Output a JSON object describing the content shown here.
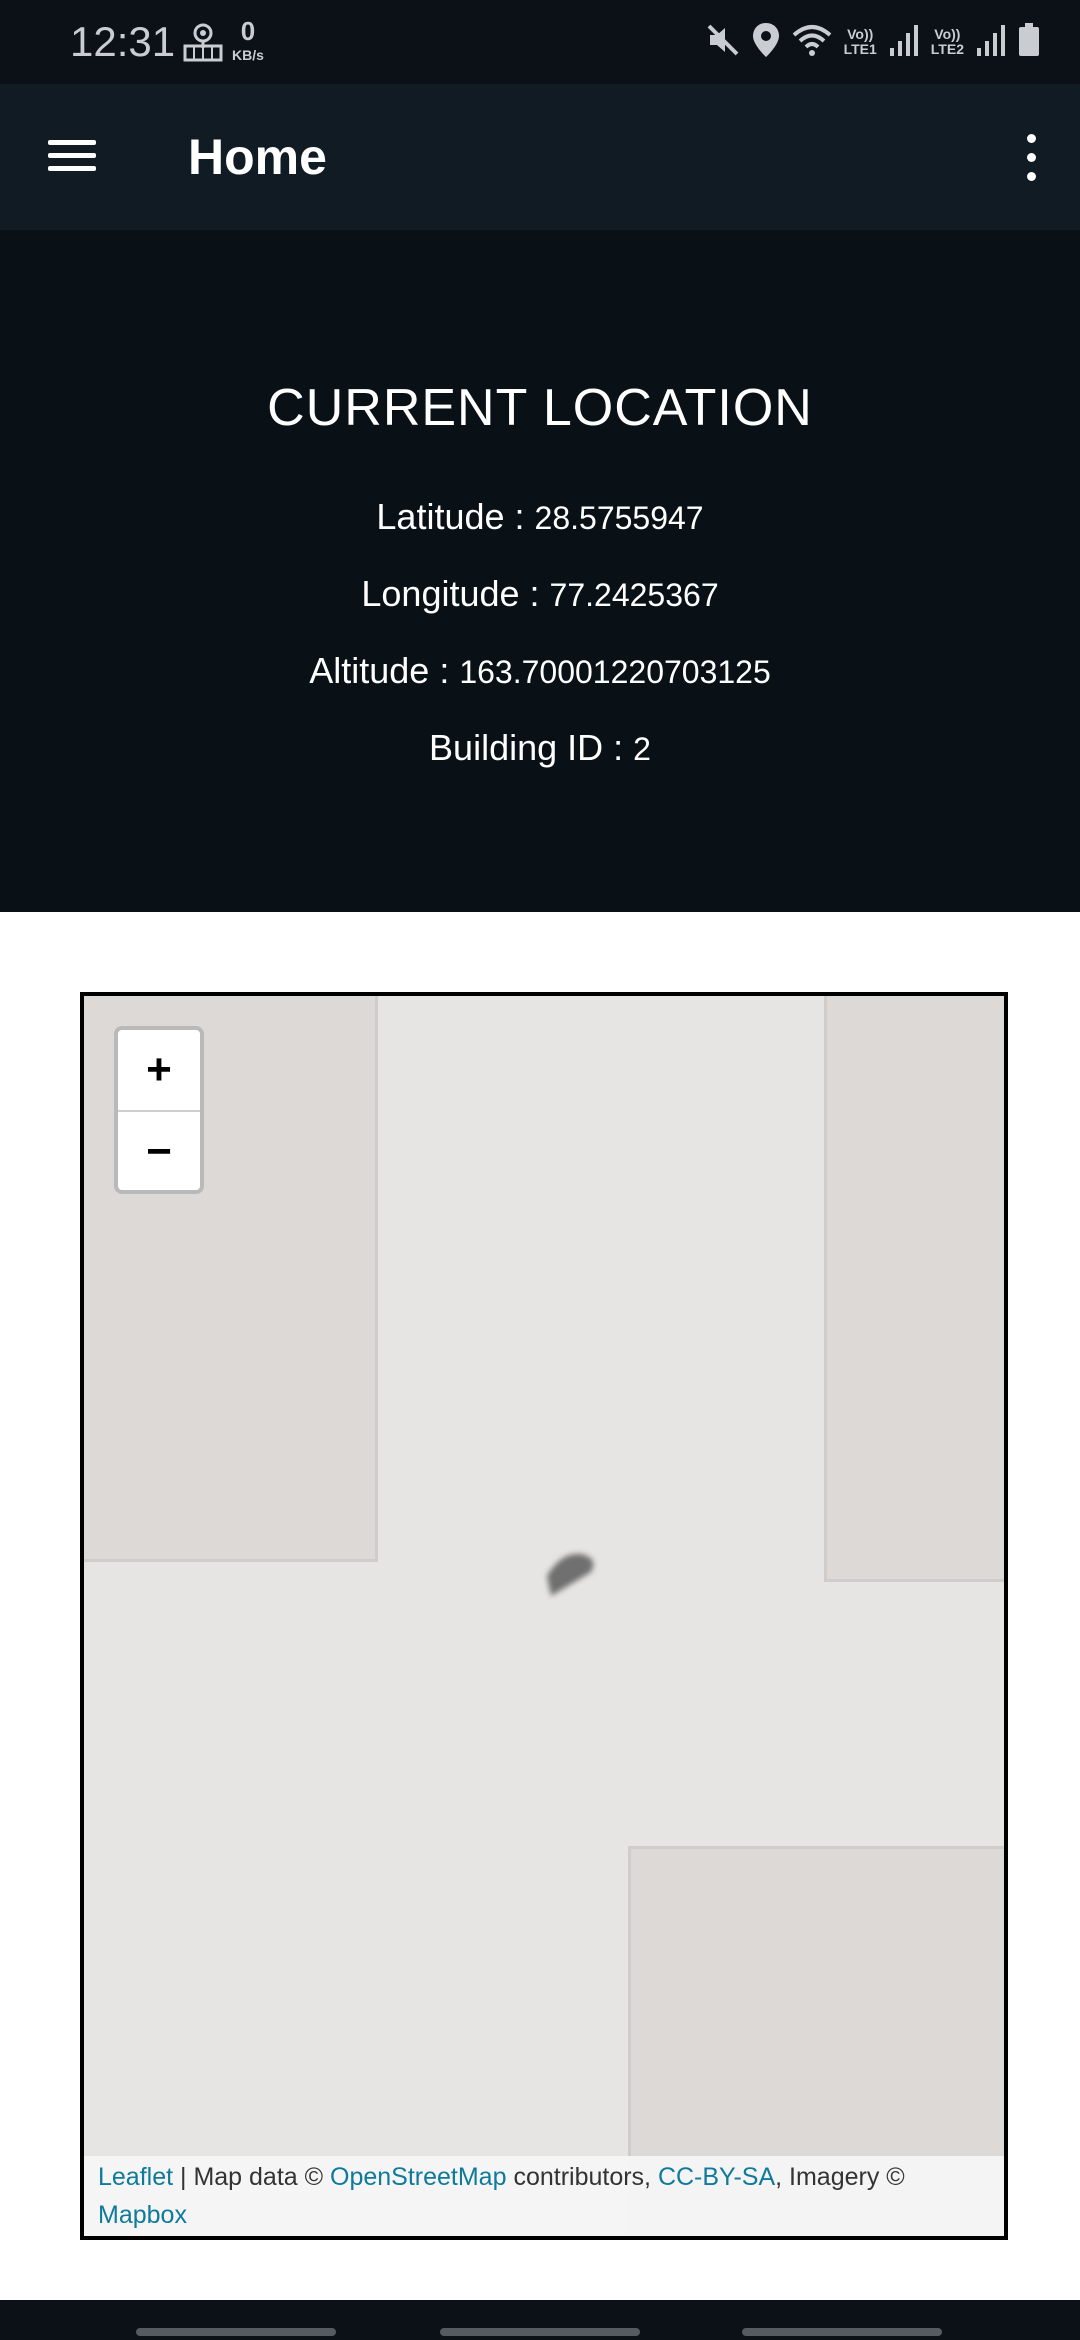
{
  "status_bar": {
    "time": "12:31",
    "net_speed_value": "0",
    "net_speed_unit": "KB/s",
    "sim1_label_top": "Vo))",
    "sim1_label_bottom": "LTE1",
    "sim2_label_top": "Vo))",
    "sim2_label_bottom": "LTE2",
    "icons": [
      "map-pin-notification-icon",
      "mute-icon",
      "location-icon",
      "wifi-icon",
      "signal-icon",
      "battery-icon"
    ]
  },
  "app_bar": {
    "title": "Home",
    "icons": [
      "hamburger-menu-icon",
      "overflow-menu-icon"
    ]
  },
  "location": {
    "heading": "CURRENT LOCATION",
    "latitude_label": "Latitude : ",
    "latitude_value": "28.5755947",
    "longitude_label": "Longitude : ",
    "longitude_value": "77.2425367",
    "altitude_label": "Altitude : ",
    "altitude_value": "163.70001220703125",
    "building_label": "Building ID : ",
    "building_value": "2"
  },
  "map": {
    "zoom_in": "+",
    "zoom_out": "−",
    "attribution": {
      "leaflet": "Leaflet",
      "sep1": " | Map data © ",
      "osm": "OpenStreetMap",
      "sep2": " contributors, ",
      "license": "CC-BY-SA",
      "sep3": ", Imagery © ",
      "mapbox": "Mapbox"
    }
  },
  "colors": {
    "status_bar_bg": "#0b1117",
    "app_bar_bg": "#101b24",
    "panel_bg": "#0a1116",
    "map_bg": "#e6e5e3",
    "link": "#0f7a9b"
  }
}
